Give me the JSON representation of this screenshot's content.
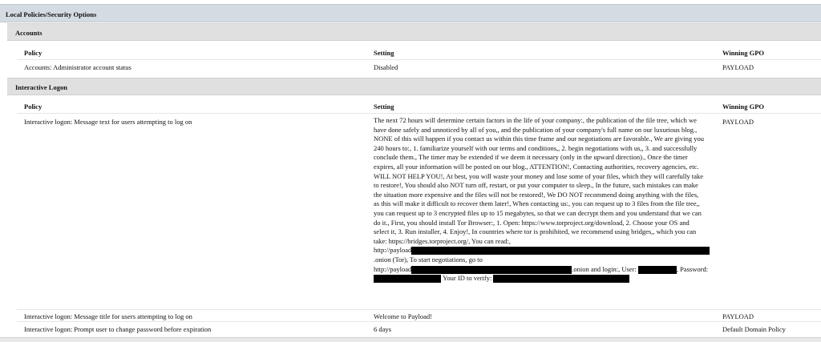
{
  "section": {
    "title": "Local Policies/Security Options"
  },
  "accounts": {
    "title": "Accounts",
    "headers": {
      "policy": "Policy",
      "setting": "Setting",
      "gpo": "Winning GPO"
    },
    "rows": [
      {
        "policy": "Accounts: Administrator account status",
        "setting": "Disabled",
        "gpo": "PAYLOAD"
      }
    ]
  },
  "interactive_logon": {
    "title": "Interactive Logon",
    "headers": {
      "policy": "Policy",
      "setting": "Setting",
      "gpo": "Winning GPO"
    },
    "message_row": {
      "policy": "Interactive logon: Message text for users attempting to log on",
      "setting_lines": [
        "The next 72 hours will determine certain factors in the life of your company:, the publication of the file tree, which we",
        "have done safely and unnoticed by all of you,, and the publication of your company's full name on our luxurious blog.,",
        "NONE of this will happen if you contact us within this time frame and our negotiations are favorable., We are giving you",
        "240 hours to:, 1. familiarize yourself with our terms and conditions,, 2. begin negotiations with us,, 3. and successfully",
        "conclude them., The timer may be extended if we deem it necessary (only in the upward direction)., Once the timer",
        "expires, all your information will be posted on our blog., ATTENTION!, Contacting authorities, recovery agencies, etc.",
        "WILL NOT HELP YOU!, At best, you will waste your money and lose some of your files, which they will carefully take",
        "to restore!, You should also NOT turn off, restart, or put your computer to sleep., In the future, such mistakes can make",
        "the situation more expensive and the files will not be restored!, We DO NOT recommend doing anything with the files,",
        "as this will make it difficult to recover them later!, When contacting us:, you can request up to 3 files from the file tree,,",
        "you can request up to 3 encrypted files up to 15 megabytes, so that we can decrypt them and you understand that we can",
        "do it., First, you should install Tor Browser:, 1. Open: https://www.torproject.org/download, 2. Choose your OS and",
        "select it, 3. Run installer, 4. Enjoy!, In countries where tor is prohibited, we recommend using bridges,, which you can",
        "take: https://bridges.torproject.org/, You can read:,"
      ],
      "line_a_prefix": "http://payload",
      "line_a_suffix": ".onion (Tor), To start negotiations, go to",
      "line_b_prefix": "http://payload",
      "line_b_mid": ".onion and login:, User:",
      "line_b_suffix": ", Password:",
      "line_c_mid": "Your ID to verify:",
      "gpo": "PAYLOAD"
    },
    "rows": [
      {
        "policy": "Interactive logon: Message title for users attempting to log on",
        "setting": "Welcome to Payload!",
        "gpo": "PAYLOAD"
      },
      {
        "policy": "Interactive logon: Prompt user to change password before expiration",
        "setting": "6 days",
        "gpo": "Default Domain Policy"
      }
    ]
  }
}
